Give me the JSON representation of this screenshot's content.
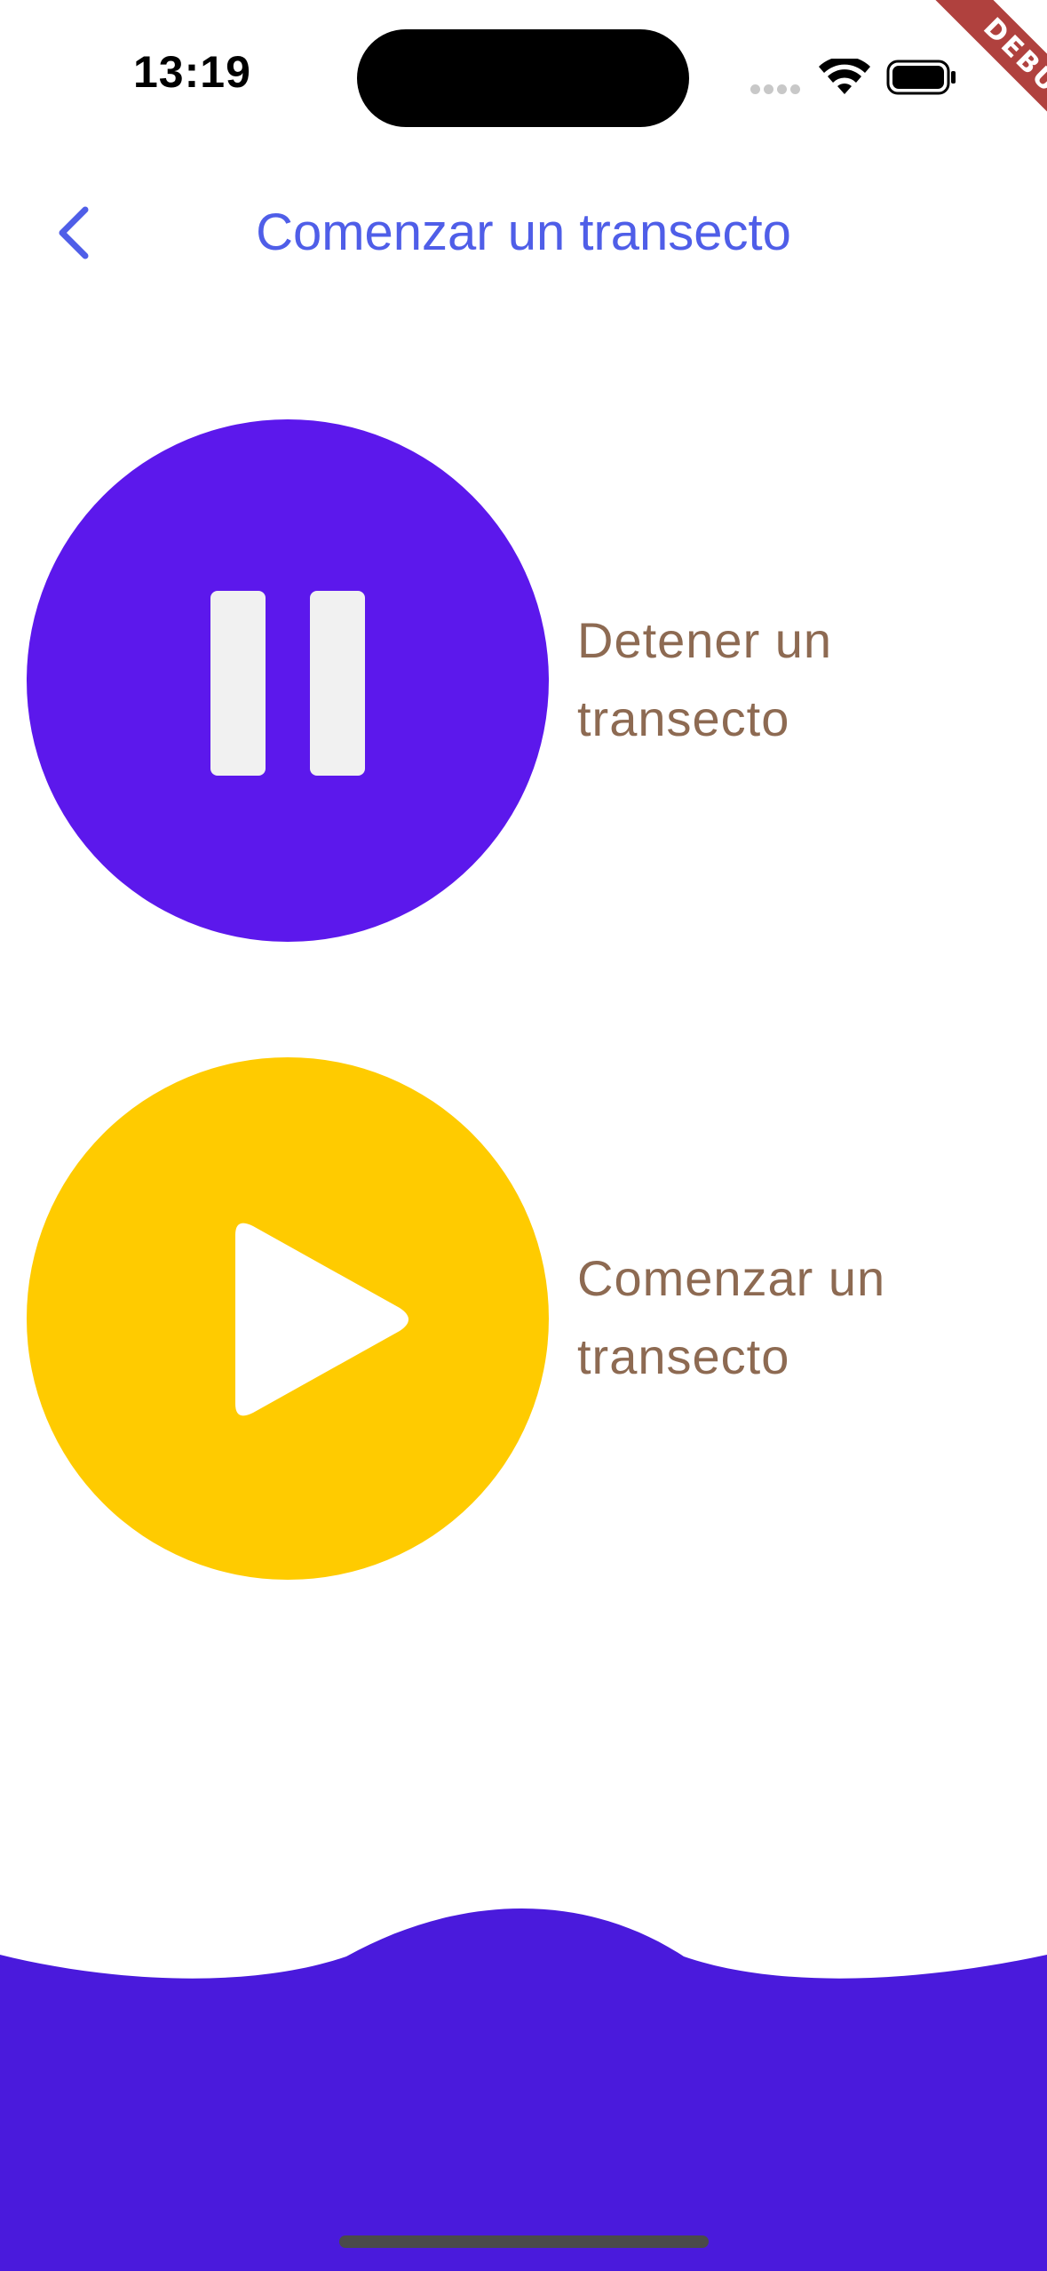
{
  "status_bar": {
    "time": "13:19",
    "wifi_icon": "wifi-icon",
    "battery_icon": "battery-icon",
    "signal_icon": "cellular-signal-icon"
  },
  "debug_banner": {
    "label": "DEBUG",
    "color": "#b0413e"
  },
  "nav": {
    "back_icon": "chevron-left-icon",
    "title": "Comenzar un transecto",
    "title_color": "#4f5ee8"
  },
  "actions": [
    {
      "icon": "pause-icon",
      "label": "Detener un transecto",
      "circle_color": "#5c18ec"
    },
    {
      "icon": "play-icon",
      "label": "Comenzar un transecto",
      "circle_color": "#ffcb00"
    }
  ],
  "footer": {
    "wave_color": "#4a1adc"
  },
  "colors": {
    "label_text": "#8d6a52",
    "background": "#ffffff"
  }
}
